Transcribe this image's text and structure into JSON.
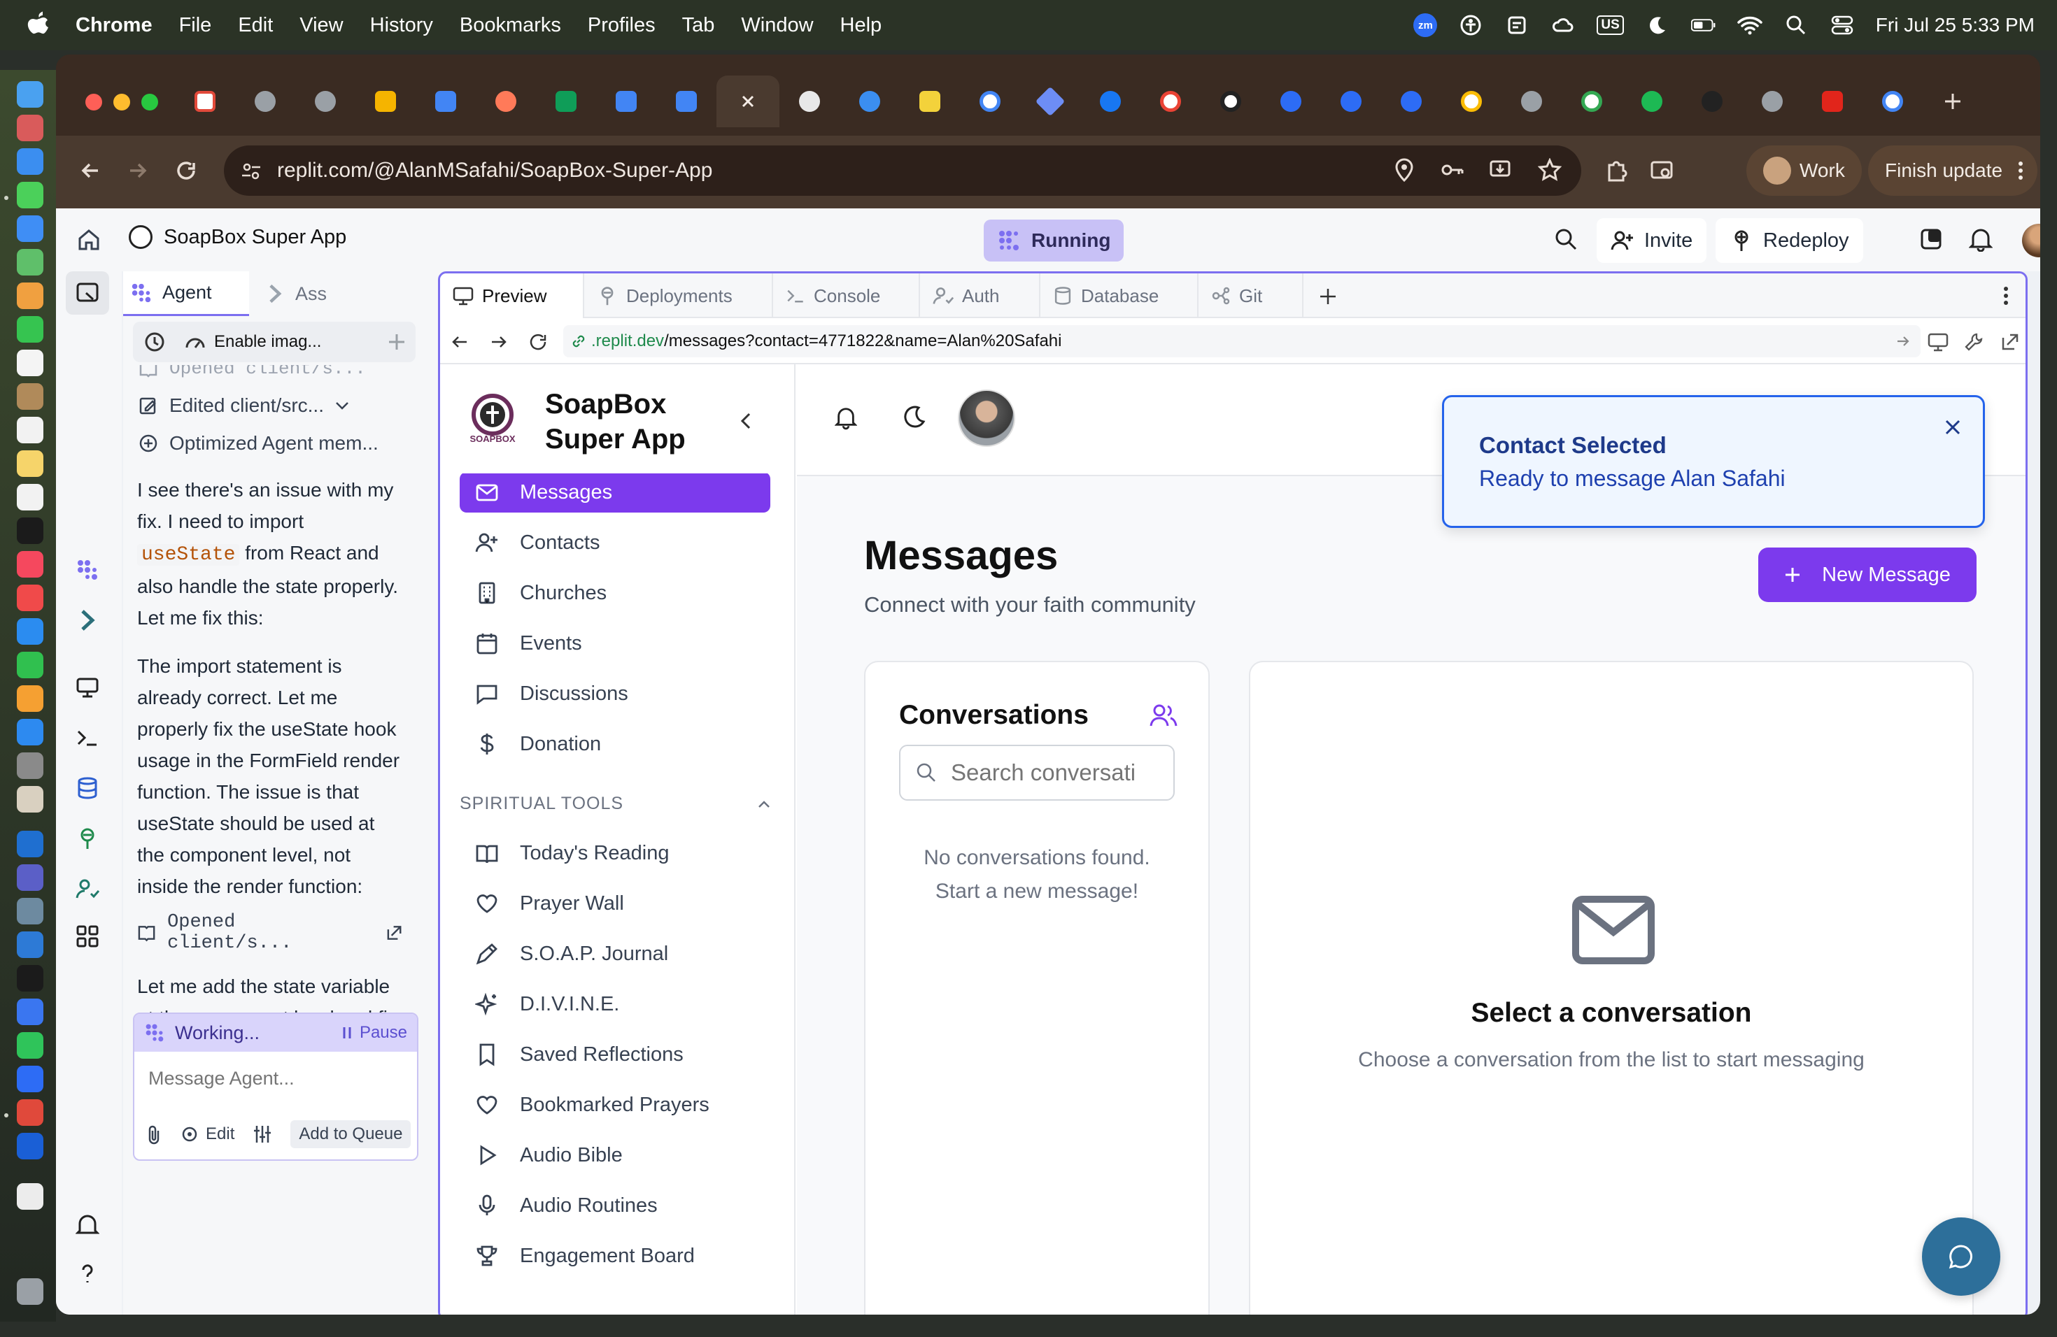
{
  "menubar": {
    "app": "Chrome",
    "items": [
      "File",
      "Edit",
      "View",
      "History",
      "Bookmarks",
      "Profiles",
      "Tab",
      "Window",
      "Help"
    ],
    "keyboard": "US",
    "datetime": "Fri Jul 25  5:33 PM"
  },
  "browser": {
    "url": "replit.com/@AlanMSafahi/SoapBox-Super-App",
    "profile": "Work",
    "update_label": "Finish update"
  },
  "replit": {
    "project_title": "SoapBox Super App",
    "status": "Running",
    "invite": "Invite",
    "redeploy": "Redeploy",
    "agent_tab": "Agent",
    "assistant_tab": "Ass",
    "enable_images": "Enable imag...",
    "activity": {
      "opened_partial": "Opened client/s...",
      "edited": "Edited client/src...",
      "optimized": "Optimized Agent mem...",
      "opened2": "Opened client/s..."
    },
    "chat": {
      "msg1_a": "I see there's an issue with my fix. I need to import ",
      "msg1_code": "useState",
      "msg1_b": " from React and also handle the state properly. Let me fix this:",
      "msg2": "The import statement is already correct. Let me properly fix the useState hook usage in the FormField render function. The issue is that useState should be used at the component level, not inside the render function:",
      "msg3": "Let me add the state variable at the component level and fix the FormField logic:"
    },
    "working": "Working...",
    "pause": "Pause",
    "input_placeholder": "Message Agent...",
    "edit": "Edit",
    "add_to_queue": "Add to Queue",
    "tabs": [
      "Preview",
      "Deployments",
      "Console",
      "Auth",
      "Database",
      "Git"
    ],
    "preview_url_host": ".replit.dev",
    "preview_url_path": "/messages?contact=4771822&name=Alan%20Safahi"
  },
  "app": {
    "brand_line1": "SoapBox",
    "brand_line2": "Super App",
    "logo_text": "SOAPBOX",
    "nav": [
      "Messages",
      "Contacts",
      "Churches",
      "Events",
      "Discussions",
      "Donation"
    ],
    "section": "SPIRITUAL TOOLS",
    "tools": [
      "Today's Reading",
      "Prayer Wall",
      "S.O.A.P. Journal",
      "D.I.V.I.N.E.",
      "Saved Reflections",
      "Bookmarked Prayers",
      "Audio Bible",
      "Audio Routines",
      "Engagement Board"
    ],
    "page_title": "Messages",
    "page_subtitle": "Connect with your faith community",
    "new_message": "New Message",
    "conversations_title": "Conversations",
    "search_placeholder": "Search conversati",
    "empty_line1": "No conversations found.",
    "empty_line2": "Start a new message!",
    "select_title": "Select a conversation",
    "select_sub": "Choose a conversation from the list to start messaging",
    "toast_title": "Contact Selected",
    "toast_body": "Ready to message Alan Safahi"
  },
  "colors": {
    "accent": "#7c3aed",
    "replit_purple": "#7c6ff0",
    "toast_border": "#2563eb",
    "fab": "#2d6f9a"
  }
}
